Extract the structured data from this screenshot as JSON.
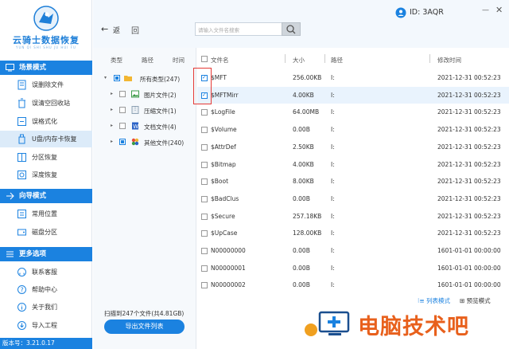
{
  "app": {
    "brand": "云骑士数据恢复",
    "brand_sub": "YUN QI SHI SHU JU HUI FU",
    "version": "版本号：3.21.0.17"
  },
  "sidebar": {
    "sections": [
      {
        "label": "场景模式",
        "items": [
          "误删除文件",
          "误清空回收站",
          "误格式化",
          "U盘/内存卡恢复",
          "分区恢复",
          "深度恢复"
        ]
      },
      {
        "label": "向导模式",
        "items": [
          "常用位置",
          "磁盘分区"
        ]
      },
      {
        "label": "更多选项",
        "items": [
          "联系客服",
          "帮助中心",
          "关于我们",
          "导入工程"
        ]
      }
    ],
    "active_item": "U盘/内存卡恢复"
  },
  "topbar": {
    "back_label": "返",
    "back_icon": "arrow-left-icon",
    "refresh_label": "回",
    "search_placeholder": "请输入文件名搜索",
    "id_label": "ID: 3AQR",
    "minimize": "—",
    "close": "✕"
  },
  "tree": {
    "headers": [
      "类型",
      "路径",
      "时间"
    ],
    "items": [
      {
        "label": "所有类型(247)",
        "icon": "folder-icon",
        "state": "partial",
        "expand": "▾"
      },
      {
        "label": "图片文件(2)",
        "icon": "image-icon",
        "state": "unchecked",
        "expand": "▸"
      },
      {
        "label": "压缩文件(1)",
        "icon": "archive-icon",
        "state": "unchecked",
        "expand": "▸"
      },
      {
        "label": "文档文件(4)",
        "icon": "document-icon",
        "state": "unchecked",
        "expand": "▸"
      },
      {
        "label": "其他文件(240)",
        "icon": "other-files-icon",
        "state": "partial",
        "expand": "▸"
      }
    ],
    "scanned_text": "扫描到247个文件(共4.81GB)",
    "export_button": "导出文件列表"
  },
  "file_list": {
    "columns": [
      "文件名",
      "大小",
      "路径",
      "修改时间"
    ],
    "rows": [
      {
        "name": "$MFT",
        "size": "256.00KB",
        "path": "I:",
        "modified": "2021-12-31 00:52:23",
        "checked": true
      },
      {
        "name": "$MFTMirr",
        "size": "4.00KB",
        "path": "I:",
        "modified": "2021-12-31 00:52:23",
        "checked": true
      },
      {
        "name": "$LogFile",
        "size": "64.00MB",
        "path": "I:",
        "modified": "2021-12-31 00:52:23",
        "checked": false
      },
      {
        "name": "$Volume",
        "size": "0.00B",
        "path": "I:",
        "modified": "2021-12-31 00:52:23",
        "checked": false
      },
      {
        "name": "$AttrDef",
        "size": "2.50KB",
        "path": "I:",
        "modified": "2021-12-31 00:52:23",
        "checked": false
      },
      {
        "name": "$Bitmap",
        "size": "4.00KB",
        "path": "I:",
        "modified": "2021-12-31 00:52:23",
        "checked": false
      },
      {
        "name": "$Boot",
        "size": "8.00KB",
        "path": "I:",
        "modified": "2021-12-31 00:52:23",
        "checked": false
      },
      {
        "name": "$BadClus",
        "size": "0.00B",
        "path": "I:",
        "modified": "2021-12-31 00:52:23",
        "checked": false
      },
      {
        "name": "$Secure",
        "size": "257.18KB",
        "path": "I:",
        "modified": "2021-12-31 00:52:23",
        "checked": false
      },
      {
        "name": "$UpCase",
        "size": "128.00KB",
        "path": "I:",
        "modified": "2021-12-31 00:52:23",
        "checked": false
      },
      {
        "name": "N00000000",
        "size": "0.00B",
        "path": "I:",
        "modified": "1601-01-01 00:00:00",
        "checked": false
      },
      {
        "name": "N00000001",
        "size": "0.00B",
        "path": "I:",
        "modified": "1601-01-01 00:00:00",
        "checked": false
      },
      {
        "name": "N00000002",
        "size": "0.00B",
        "path": "I:",
        "modified": "1601-01-01 00:00:00",
        "checked": false
      }
    ],
    "list_mode": "列表模式",
    "preview_mode": "预览模式"
  },
  "watermark": {
    "text": "电脑技术吧"
  },
  "colors": {
    "accent": "#1b82e0",
    "highlight": "#e53935",
    "watermark": "#e8601c"
  }
}
